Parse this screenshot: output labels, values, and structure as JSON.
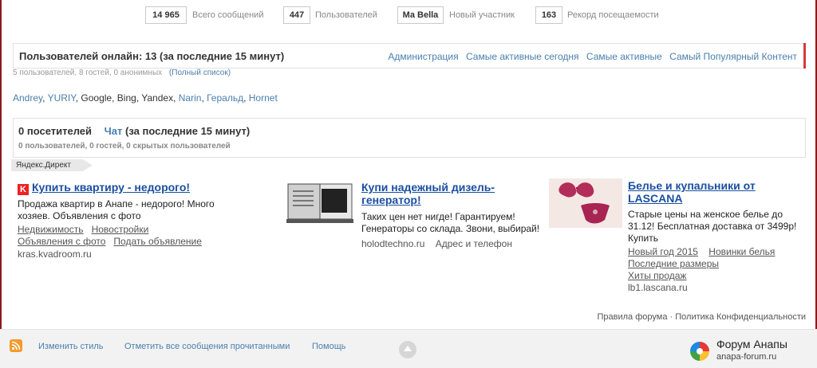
{
  "stats": [
    {
      "value": "14 965",
      "label": "Всего сообщений"
    },
    {
      "value": "447",
      "label": "Пользователей"
    },
    {
      "value": "Ma Bella",
      "label": "Новый участник"
    },
    {
      "value": "163",
      "label": "Рекорд посещаемости"
    }
  ],
  "online": {
    "title": "Пользователей онлайн: 13 (за последние 15 минут)",
    "links": [
      "Администрация",
      "Самые активные сегодня",
      "Самые активные",
      "Самый Популярный Контент"
    ],
    "summary": "5 пользователей, 8 гостей, 0 анонимных",
    "full_list": "(Полный список)",
    "users": [
      {
        "name": "Andrey",
        "type": "user"
      },
      {
        "name": "YURIY",
        "type": "user"
      },
      {
        "name": "Google",
        "type": "bot"
      },
      {
        "name": "Bing",
        "type": "bot"
      },
      {
        "name": "Yandex",
        "type": "bot"
      },
      {
        "name": "Narin",
        "type": "user"
      },
      {
        "name": "Геральд",
        "type": "user"
      },
      {
        "name": "Hornet",
        "type": "user"
      }
    ]
  },
  "visitors": {
    "count": "0 посетителей",
    "chat": "Чат",
    "period": "(за последние 15 минут)",
    "summary": "0 пользователей, 0 гостей, 0 скрытых пользователей"
  },
  "yandex_direct": "Яндекс.Директ",
  "ads": {
    "kvartira": {
      "title": "Купить квартиру - недорого!",
      "text": "Продажа квартир в Анапе - недорого! Много хозяев. Объявления с фото",
      "links": [
        "Недвижимость",
        "Новостройки",
        "Объявления с фото",
        "Подать объявление"
      ],
      "domain": "kras.kvadroom.ru"
    },
    "generator": {
      "title": "Купи надежный дизель-генератор!",
      "text": "Таких цен нет нигде! Гарантируем! Генераторы со склада. Звони, выбирай!",
      "domain": "holodtechno.ru",
      "extra": "Адрес и телефон"
    },
    "lascana": {
      "title": "Белье и купальники от LASCANA",
      "text": "Старые цены на женское белье до 31.12! Бесплатная доставка от 3499р! Купить",
      "links": [
        "Новый год 2015",
        "Новинки белья",
        "Последние размеры",
        "Хиты продаж"
      ],
      "domain": "lb1.lascana.ru"
    }
  },
  "legal": {
    "rules": "Правила форума",
    "sep": "·",
    "privacy": "Политика Конфиденциальности"
  },
  "footer": {
    "change_style": "Изменить стиль",
    "mark_read": "Отметить все сообщения прочитанными",
    "help": "Помощь",
    "brand_name": "Форум Анапы",
    "brand_url": "anapa-forum.ru"
  }
}
